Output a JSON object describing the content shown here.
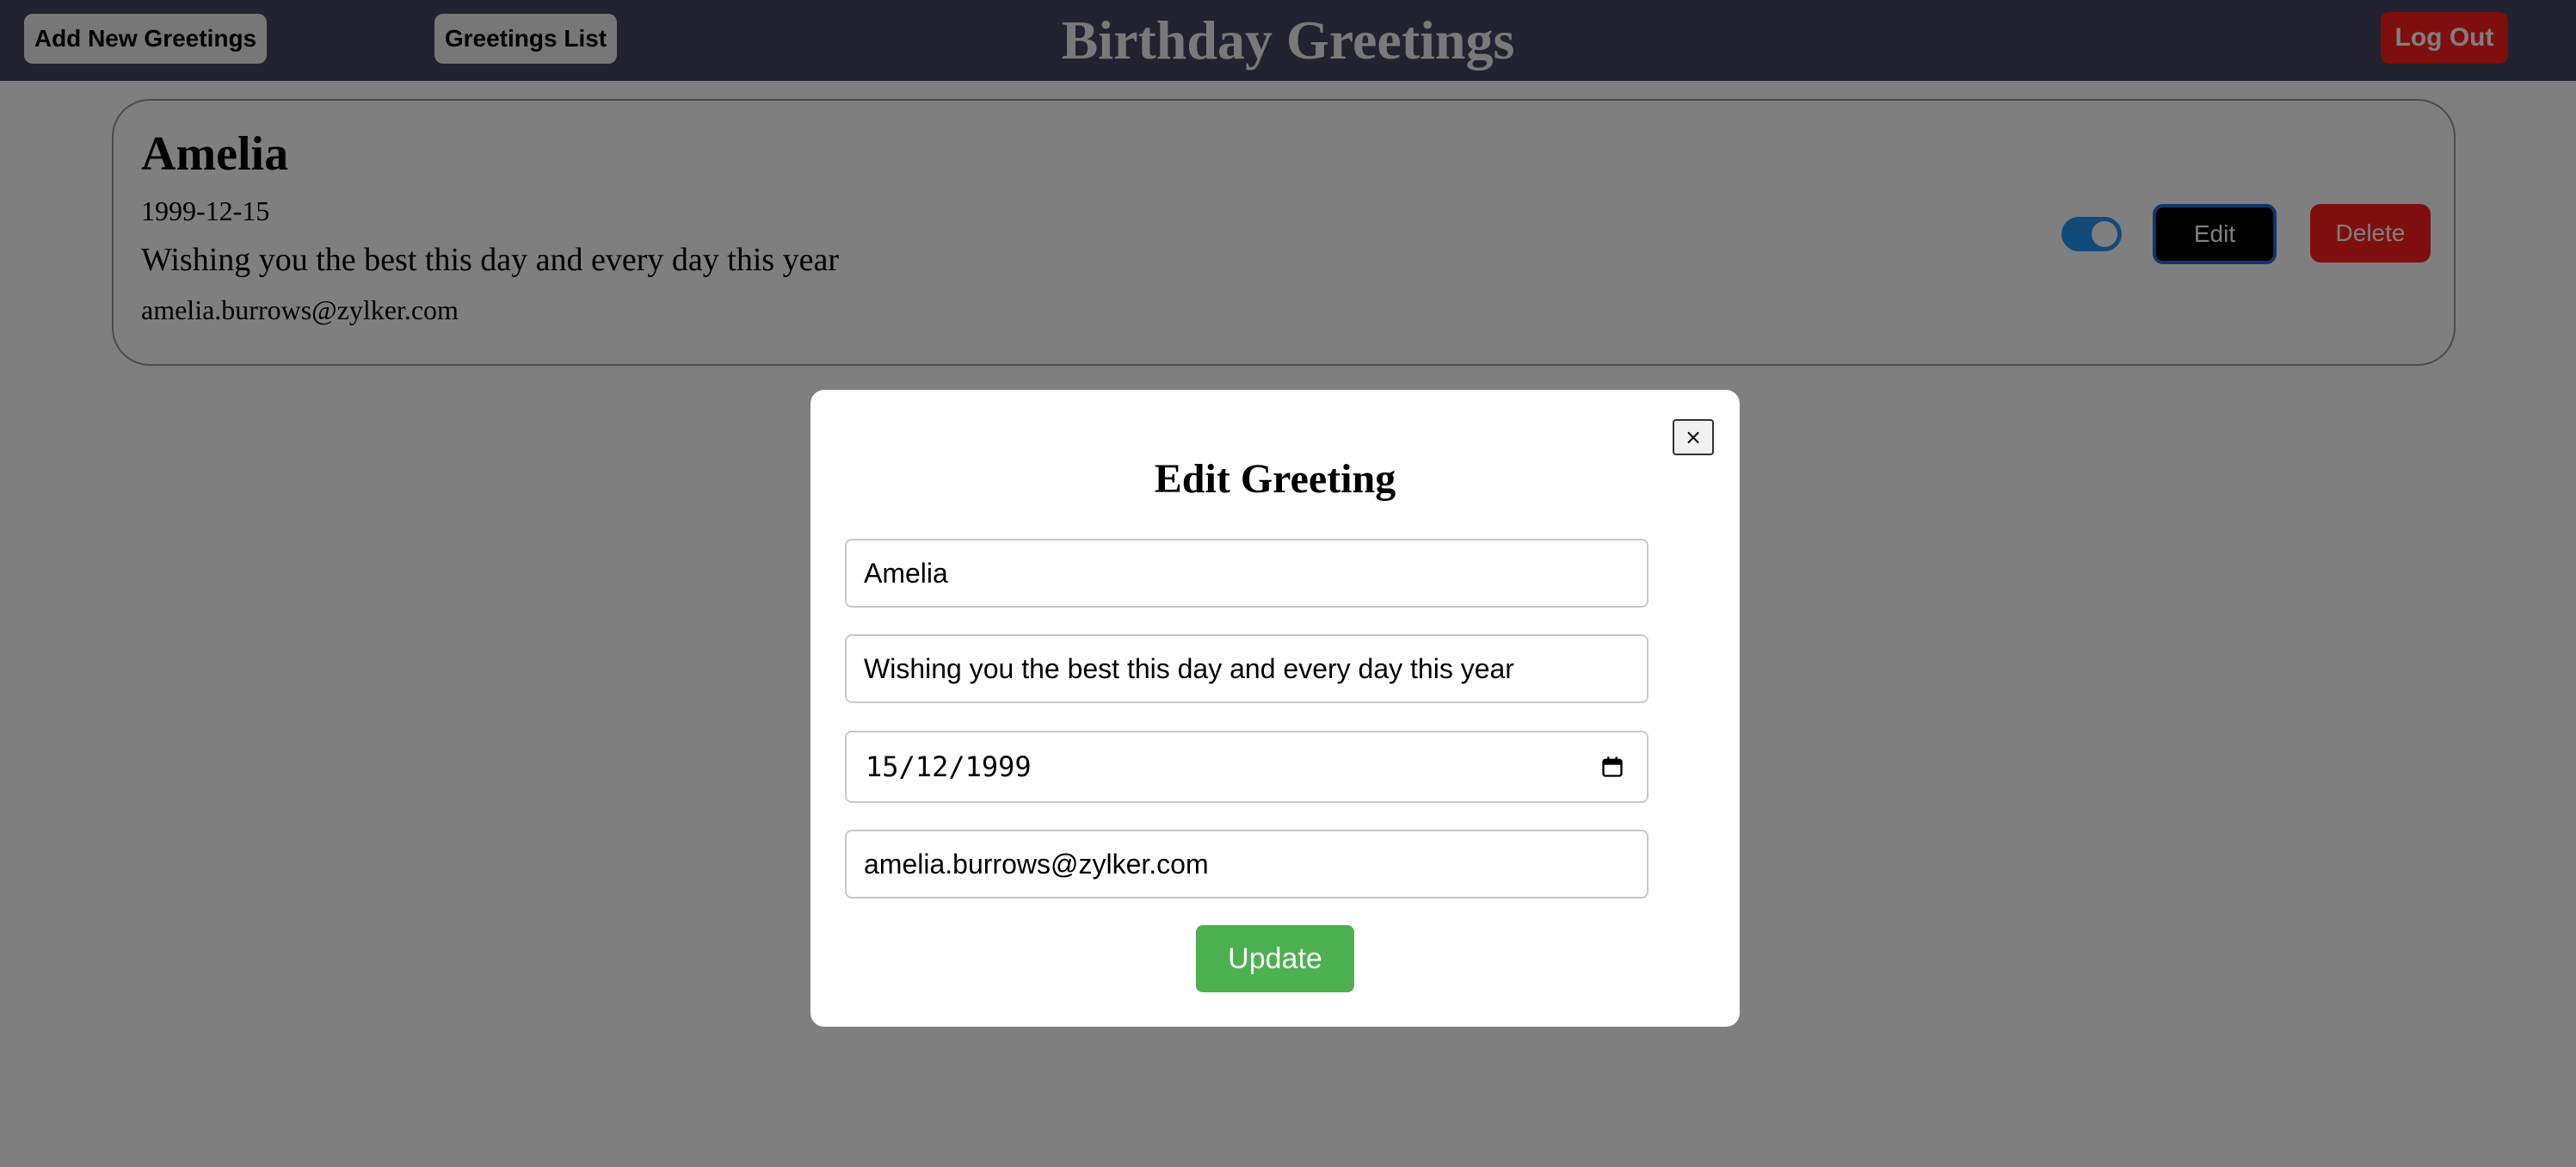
{
  "header": {
    "add_button": "Add New Greetings",
    "list_button": "Greetings List",
    "title": "Birthday Greetings",
    "logout_button": "Log Out"
  },
  "greeting_card": {
    "name": "Amelia",
    "date": "1999-12-15",
    "message": "Wishing you the best this day and every day this year",
    "email": "amelia.burrows@zylker.com",
    "toggle_on": true,
    "edit_button": "Edit",
    "delete_button": "Delete"
  },
  "modal": {
    "close_label": "×",
    "title": "Edit Greeting",
    "name_value": "Amelia",
    "message_value": "Wishing you the best this day and every day this year",
    "date_value": "15/12/1999",
    "email_value": "amelia.burrows@zylker.com",
    "update_button": "Update",
    "calendar_icon": "calendar-icon"
  },
  "colors": {
    "header_bg": "#454460",
    "logout_bg": "#ff1e1e",
    "delete_bg": "#ff1e1e",
    "edit_bg": "#000000",
    "edit_border": "#1e6bd6",
    "toggle_bg": "#2196f3",
    "update_bg": "#4caf50",
    "overlay": "rgba(0,0,0,0.5)"
  }
}
